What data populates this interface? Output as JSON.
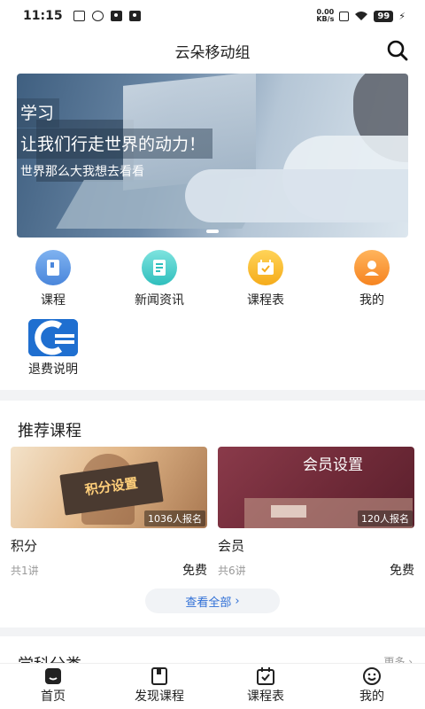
{
  "status_bar": {
    "time": "11:15",
    "speed_value": "0.00",
    "speed_unit": "KB/s",
    "battery": "99"
  },
  "header": {
    "title": "云朵移动组"
  },
  "banner": {
    "tag": "学习",
    "slogan": "让我们行走世界的动力！",
    "subtitle": "世界那么大我想去看看"
  },
  "quick_menu": [
    {
      "label": "课程",
      "icon": "book-icon"
    },
    {
      "label": "新闻资讯",
      "icon": "news-icon"
    },
    {
      "label": "课程表",
      "icon": "calendar-icon"
    },
    {
      "label": "我的",
      "icon": "user-icon"
    },
    {
      "label": "退费说明",
      "icon": "refund-logo-icon"
    }
  ],
  "recommend": {
    "title": "推荐课程",
    "courses": [
      {
        "cover_text": "积分设置",
        "enrolled": "1036人报名",
        "name": "积分",
        "lessons": "共1讲",
        "price": "免费"
      },
      {
        "cover_text": "会员设置",
        "enrolled": "120人报名",
        "name": "会员",
        "lessons": "共6讲",
        "price": "免费"
      }
    ],
    "view_all": "查看全部"
  },
  "category": {
    "title": "学科分类",
    "more": "更多"
  },
  "tabbar": [
    {
      "label": "首页",
      "icon": "home-icon"
    },
    {
      "label": "发现课程",
      "icon": "discover-icon"
    },
    {
      "label": "课程表",
      "icon": "schedule-icon"
    },
    {
      "label": "我的",
      "icon": "smile-icon"
    }
  ],
  "colors": {
    "accent": "#2f6fd6",
    "background": "#f2f3f5"
  }
}
